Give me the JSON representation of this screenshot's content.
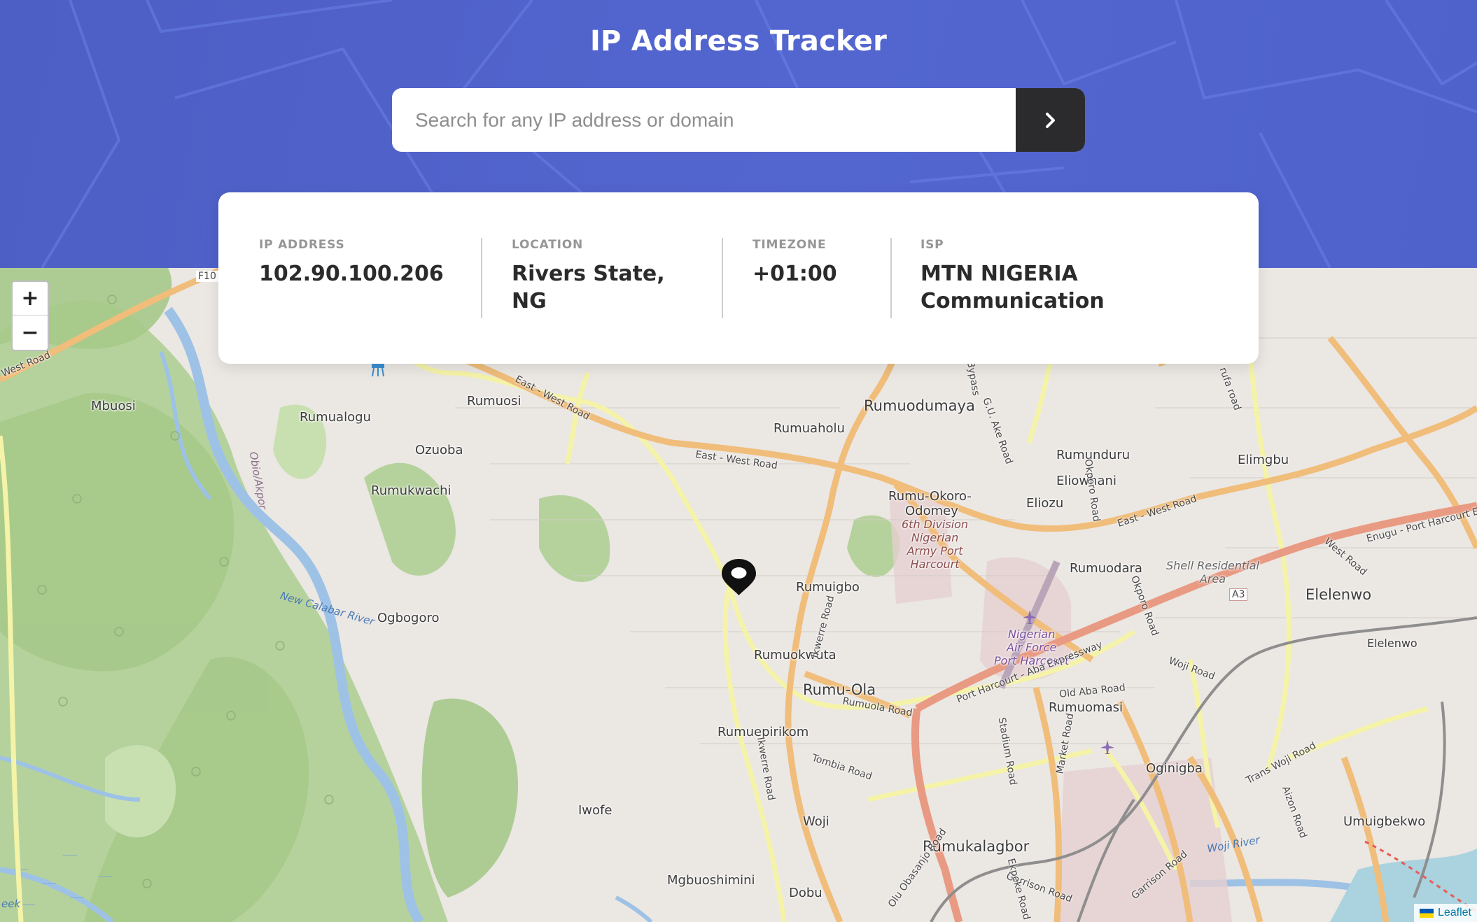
{
  "header": {
    "title": "IP Address Tracker",
    "search_placeholder": "Search for any IP address or domain",
    "search_value": "",
    "submit_icon": "chevron-right-icon"
  },
  "info": {
    "ip_address": {
      "label": "IP ADDRESS",
      "value": "102.90.100.206"
    },
    "location": {
      "label": "LOCATION",
      "value_line1": "Rivers State,",
      "value_line2": "NG"
    },
    "timezone": {
      "label": "TIMEZONE",
      "value": "+01:00"
    },
    "isp": {
      "label": "ISP",
      "value_line1": "MTN NIGERIA",
      "value_line2": "Communication"
    }
  },
  "map": {
    "zoom_in": "+",
    "zoom_out": "−",
    "attribution": "Leaflet",
    "places": {
      "mbuosi": "Mbuosi",
      "rumualogu": "Rumualogu",
      "rumuosi": "Rumuosi",
      "rumuodumaya": "Rumuodumaya",
      "ozuoba": "Ozuoba",
      "rumuaholu": "Rumuaholu",
      "rumukwachi": "Rumukwachi",
      "rumunduru": "Rumunduru",
      "elimgbu": "Elimgbu",
      "eliowhani": "Eliowhani",
      "rumu_okoro": "Rumu-Okoro-",
      "odomey": "Odomey",
      "eliozu": "Eliozu",
      "rumuigbo": "Rumuigbo",
      "rumuodara": "Rumuodara",
      "elelenwo": "Elelenwo",
      "elelenwo_small": "Elelenwo",
      "ogbogoro": "Ogbogoro",
      "rumuokwuta": "Rumuokwuta",
      "rumu_ola": "Rumu-Ola",
      "rumuomasi": "Rumuomasi",
      "rumuepirikom": "Rumuepirikom",
      "oginigba": "Oginigba",
      "iwofe": "Iwofe",
      "woji": "Woji",
      "umuigbekwo": "Umuigbekwo",
      "rumukalagbor": "Rumukalagbor",
      "mgbuoshimini": "Mgbuoshimini",
      "dobu": "Dobu"
    },
    "areas": {
      "army_1": "6th Division",
      "army_2": "Nigerian",
      "army_3": "Army Port",
      "army_4": "Harcourt",
      "shell_1": "Shell Residential",
      "shell_2": "Area",
      "airforce_1": "Nigerian",
      "airforce_2": "Air Force",
      "airforce_3": "Port Harcourt"
    },
    "roads": {
      "east_west_1": "East - West Road",
      "east_west_2": "East - West Road",
      "east_west_3": "East - West Road",
      "west_road": "West Road",
      "f10": "F10",
      "a3": "A3",
      "enugu": "Enugu - Port Harcourt E",
      "ph_aba": "Port Harcourt - Aba Expressway",
      "rumuola_road": "Rumuola Road",
      "old_aba": "Old Aba Road",
      "ikwerre_1": "Ikwerre Road",
      "ikwerre_2": "Ikwerre Road",
      "tombia": "Tombia Road",
      "stadium": "Stadium Road",
      "market": "Market Road",
      "woji_road": "Woji Road",
      "trans_woji": "Trans Woji Road",
      "aizon": "Aizon Road",
      "garrison_1": "Garrison Road",
      "garrison_2": "Garrison Road",
      "olu_obasanjo": "Olu Obasanjo Road",
      "ekpeke": "Ekpeke Road",
      "okporo_1": "Okporo Road",
      "okporo_2": "Okporo Road",
      "gu_ake": "G.U. Ake Road",
      "bypass": "Bypass",
      "rufa": "rufa road",
      "west_road_2": "West Road"
    },
    "rivers": {
      "new_calabar": "New Calabar River",
      "obio_akpor": "Obio/Akpor",
      "woji_river": "Woji River",
      "creek": "eek"
    }
  }
}
